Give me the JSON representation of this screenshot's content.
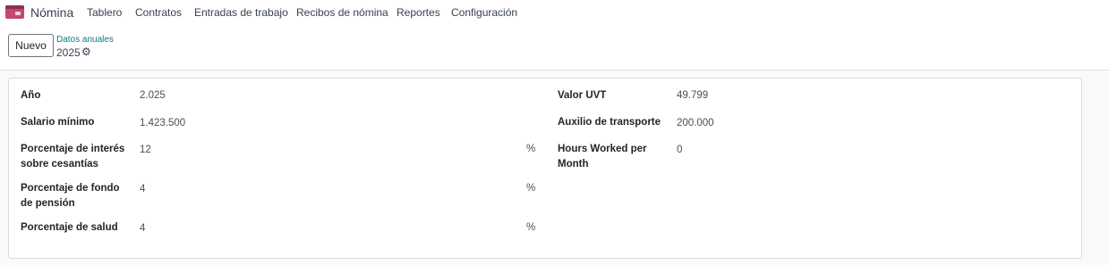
{
  "app": {
    "name": "Nómina"
  },
  "menu": [
    "Tablero",
    "Contratos",
    "Entradas de trabajo",
    "Recibos de nómina",
    "Reportes",
    "Configuración"
  ],
  "control": {
    "new_label": "Nuevo",
    "breadcrumb": "Datos anuales",
    "record": "2025"
  },
  "form": {
    "left": [
      {
        "label": "Año",
        "value": "2.025",
        "unit": ""
      },
      {
        "label": "Salario mínimo",
        "value": "1.423.500",
        "unit": ""
      },
      {
        "label": "Porcentaje de interés sobre cesantías",
        "value": "12",
        "unit": "%"
      },
      {
        "label": "Porcentaje de fondo de pensión",
        "value": "4",
        "unit": "%"
      },
      {
        "label": "Porcentaje de salud",
        "value": "4",
        "unit": "%"
      }
    ],
    "right": [
      {
        "label": "Valor UVT",
        "value": "49.799"
      },
      {
        "label": "Auxilio de transporte",
        "value": "200.000"
      },
      {
        "label": "Hours Worked per Month",
        "value": "0"
      }
    ]
  },
  "colors": {
    "accent": "#017e84",
    "app_icon": "#c04a6b"
  }
}
